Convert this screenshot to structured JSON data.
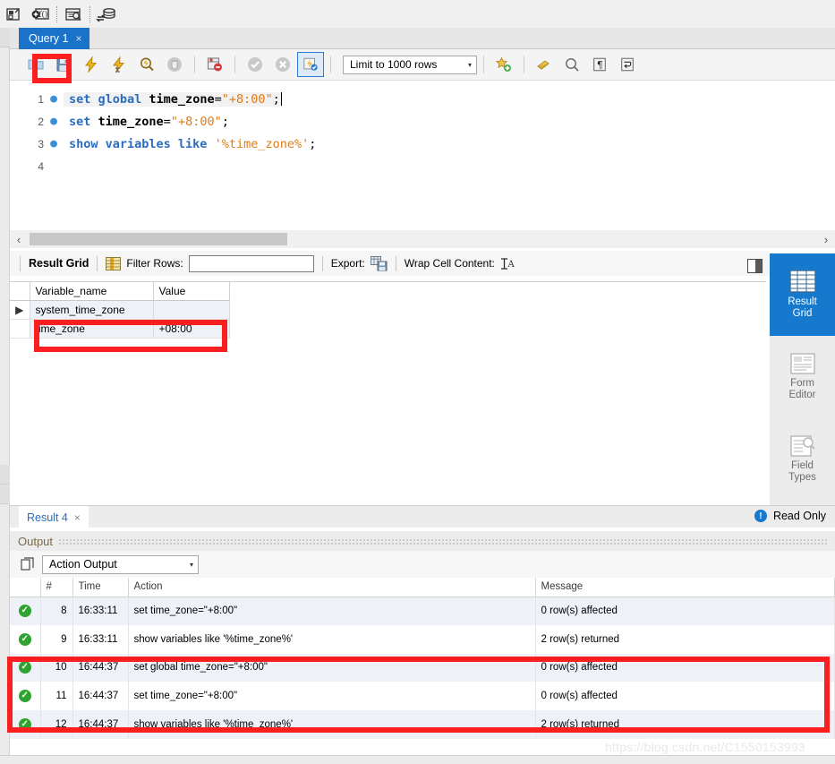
{
  "top_toolbar": {
    "icons": [
      {
        "name": "schema-inspector-icon",
        "title": "Create Schema"
      },
      {
        "name": "create-function-icon",
        "title": "Create Function"
      },
      {
        "name": "inspect-table-icon",
        "title": "Inspect Table"
      },
      {
        "name": "sync-database-icon",
        "title": "Sync Database"
      }
    ]
  },
  "query_tab": {
    "label": "Query 1",
    "close": "×"
  },
  "editor_toolbar": {
    "buttons": [
      {
        "name": "open-script-icon",
        "title": "Open SQL Script"
      },
      {
        "name": "save-script-icon",
        "title": "Save SQL Script"
      },
      {
        "name": "execute-statement-icon",
        "title": "Execute"
      },
      {
        "name": "execute-current-statement-icon",
        "title": "Execute Current Statement"
      },
      {
        "name": "explain-statement-icon",
        "title": "Explain"
      },
      {
        "name": "stop-execution-icon",
        "title": "Stop"
      },
      {
        "name": "toggle-stop-on-error-icon",
        "title": "Toggle Stop On Error"
      },
      {
        "name": "commit-icon",
        "title": "Commit"
      },
      {
        "name": "rollback-icon",
        "title": "Rollback"
      },
      {
        "name": "toggle-autocommit-icon",
        "title": "Toggle Autocommit"
      }
    ],
    "limit_label": "Limit to 1000 rows",
    "limit_caret": "▾",
    "right_icons": [
      {
        "name": "beautify-sql-icon",
        "title": "Beautify SQL"
      },
      {
        "name": "find-icon",
        "title": "Find"
      },
      {
        "name": "toggle-invisible-chars-icon",
        "title": "Show Invisible Characters"
      },
      {
        "name": "toggle-wrapping-icon",
        "title": "Toggle Wrapping"
      }
    ]
  },
  "editor": {
    "lines": [
      {
        "num": "1",
        "dot": "●",
        "current": true,
        "tokens": [
          {
            "t": "set ",
            "c": "kw"
          },
          {
            "t": "global ",
            "c": "kw"
          },
          {
            "t": "time_zone",
            "c": "ident"
          },
          {
            "t": "=",
            "c": "op"
          },
          {
            "t": "\"+8:00\"",
            "c": "str"
          },
          {
            "t": ";",
            "c": "op"
          }
        ],
        "caret": true
      },
      {
        "num": "2",
        "dot": "●",
        "current": false,
        "tokens": [
          {
            "t": "set ",
            "c": "kw"
          },
          {
            "t": "time_zone",
            "c": "ident"
          },
          {
            "t": "=",
            "c": "op"
          },
          {
            "t": "\"+8:00\"",
            "c": "str"
          },
          {
            "t": ";",
            "c": "op"
          }
        ],
        "caret": false
      },
      {
        "num": "3",
        "dot": "●",
        "current": false,
        "tokens": [
          {
            "t": "show ",
            "c": "kw"
          },
          {
            "t": "variables ",
            "c": "kw"
          },
          {
            "t": "like ",
            "c": "kw"
          },
          {
            "t": "'%time_zone%'",
            "c": "str"
          },
          {
            "t": ";",
            "c": "op"
          }
        ],
        "caret": false
      },
      {
        "num": "4",
        "dot": "",
        "current": false,
        "tokens": [],
        "caret": false
      }
    ]
  },
  "editor_scrollbar": {
    "left_arrow": "‹",
    "right_arrow": "›"
  },
  "result_toolbar": {
    "title": "Result Grid",
    "grid_icon": "result-grid-icon",
    "filter_label": "Filter Rows:",
    "filter_value": "",
    "filter_placeholder": "",
    "export_label": "Export:",
    "export_icon": "export-icon",
    "wrap_label": "Wrap Cell Content:",
    "wrap_icon": "wrap-cell-icon"
  },
  "result_grid": {
    "columns": [
      "",
      "Variable_name",
      "Value"
    ],
    "rows": [
      {
        "marker": "▶",
        "variable_name": "system_time_zone",
        "value": ""
      },
      {
        "marker": "",
        "variable_name": "time_zone",
        "value": "+08:00"
      }
    ]
  },
  "right_panel": {
    "items": [
      {
        "label_line1": "Result",
        "label_line2": "Grid",
        "icon": "result-grid-icon",
        "active": true
      },
      {
        "label_line1": "Form",
        "label_line2": "Editor",
        "icon": "form-editor-icon",
        "active": false
      },
      {
        "label_line1": "Field",
        "label_line2": "Types",
        "icon": "field-types-icon",
        "active": false
      }
    ],
    "chevron": "⌄"
  },
  "result_tab": {
    "label": "Result 4",
    "close": "×",
    "read_only": "Read Only",
    "info_icon": "info-icon"
  },
  "output": {
    "header_label": "Output",
    "copy_icon": "copy-icon",
    "select_label": "Action Output",
    "select_caret": "▾",
    "columns": [
      "",
      "#",
      "Time",
      "Action",
      "Message"
    ],
    "rows": [
      {
        "status": "✓",
        "num": "8",
        "time": "16:33:11",
        "action": "set time_zone=\"+8:00\"",
        "message": "0 row(s) affected"
      },
      {
        "status": "✓",
        "num": "9",
        "time": "16:33:11",
        "action": "show variables like '%time_zone%'",
        "message": "2 row(s) returned"
      },
      {
        "status": "✓",
        "num": "10",
        "time": "16:44:37",
        "action": "set global time_zone=\"+8:00\"",
        "message": "0 row(s) affected"
      },
      {
        "status": "✓",
        "num": "11",
        "time": "16:44:37",
        "action": "set time_zone=\"+8:00\"",
        "message": "0 row(s) affected"
      },
      {
        "status": "✓",
        "num": "12",
        "time": "16:44:37",
        "action": "show variables like '%time_zone%'",
        "message": "2 row(s) returned"
      }
    ]
  },
  "watermark": "https://blog.csdn.net/C1550153993",
  "colors": {
    "accent": "#1779cd",
    "tab_active": "#1a73c8",
    "annotation_red": "#fb1f1f",
    "keyword_blue": "#2a6dbd",
    "string_orange": "#e07b18",
    "success_green": "#2fa32f",
    "row_stripe": "#eef1f8"
  }
}
